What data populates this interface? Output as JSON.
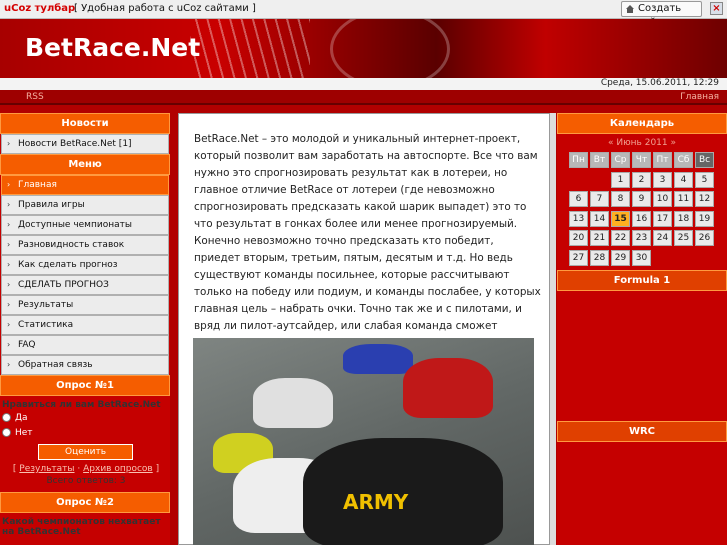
{
  "toolbar": {
    "brand": "uCoz тулбар",
    "slogan": "[ Удобная работа с uCoz сайтами ]",
    "create_label": "Создать сайт",
    "close_label": "×"
  },
  "header": {
    "title": "BetRace.Net",
    "date": "Среда, 15.06.2011, 12:29",
    "nav_left": "RSS",
    "nav_right": "Главная"
  },
  "left": {
    "news_title": "Новости",
    "news_item": "Новости BetRace.Net [1]",
    "menu_title": "Меню",
    "menu": [
      "Главная",
      "Правила игры",
      "Доступные чемпионаты",
      "Разновидность ставок",
      "Как сделать прогноз",
      "СДЕЛАТЬ ПРОГНОЗ",
      "Результаты",
      "Статистика",
      "FAQ",
      "Обратная связь"
    ],
    "poll1_title": "Опрос №1",
    "poll1_question": "Нравиться ли вам BetRace.Net",
    "poll1_options": [
      "Да",
      "Нет"
    ],
    "vote_label": "Оценить",
    "poll1_links_l": "Результаты",
    "poll1_links_r": "Архив опросов",
    "poll1_total": "Всего ответов: 3",
    "poll2_title": "Опрос №2",
    "poll2_question": "Какой чемпионатов нехватает на BetRace.Net"
  },
  "main": {
    "text": "BetRace.Net – это молодой и уникальный интернет-проект, который позволит вам заработать на автоспорте. Все что вам нужно это спрогнозировать результат как в лотереи, но главное отличие BetRace от лотереи (где невозможно спрогнозировать предсказать какой шарик выпадет) это то что результат в гонках более или менее прогнозируемый. Конечно невозможно точно предсказать кто победит, приедет вторым, третьим, пятым, десятым и т.д. Но ведь существуют команды посильнее, которые рассчитывают только на победу или подиум, и команды послабее, у которых главная цель – набрать очки. Точно так же и с пилотами, и вряд ли пилот-аутсайдер, или слабая команда сможет выиграть или попасть на подиум, хотя и такое иногда случается. За что мы и любим автоспорт!",
    "photo_label": "ARMY"
  },
  "right": {
    "calendar_title": "Календарь",
    "month": "« Июнь 2011 »",
    "weekdays": [
      "Пн",
      "Вт",
      "Ср",
      "Чт",
      "Пт",
      "Сб",
      "Вс"
    ],
    "days": [
      "",
      "",
      "1",
      "2",
      "3",
      "4",
      "5",
      "6",
      "7",
      "8",
      "9",
      "10",
      "11",
      "12",
      "13",
      "14",
      "15",
      "16",
      "17",
      "18",
      "19",
      "20",
      "21",
      "22",
      "23",
      "24",
      "25",
      "26",
      "27",
      "28",
      "29",
      "30"
    ],
    "today": "15",
    "block2": "Formula 1",
    "block3": "WRC"
  }
}
